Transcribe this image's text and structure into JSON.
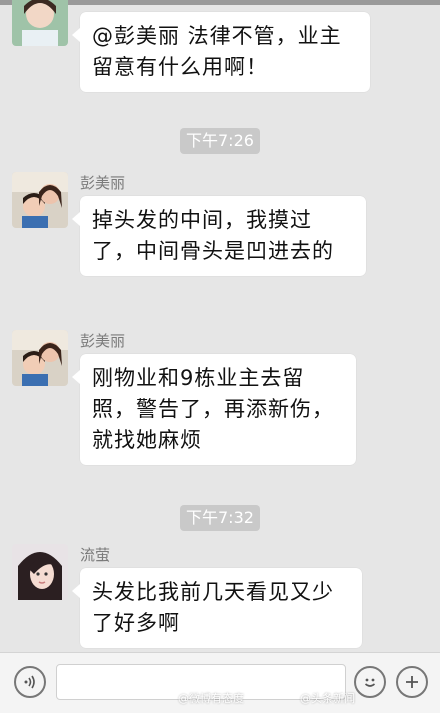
{
  "messages": [
    {
      "sender": "",
      "text": "@彭美丽 法律不管，业主留意有什么用啊！"
    },
    {
      "sender": "彭美丽",
      "text": "掉头发的中间，我摸过了，中间骨头是凹进去的"
    },
    {
      "sender": "彭美丽",
      "text": "刚物业和9栋业主去留照，警告了，再添新伤，就找她麻烦"
    },
    {
      "sender": "流萤",
      "text": "头发比我前几天看见又少了好多啊"
    }
  ],
  "timestamps": [
    "下午7:26",
    "下午7:32"
  ],
  "input_bar": {
    "text_value": "",
    "icons": [
      "voice-icon",
      "emoji-icon",
      "plus-icon"
    ]
  },
  "watermarks": [
    "@微博有态度",
    "@头条新闻"
  ],
  "colors": {
    "background": "#e6e6e6",
    "bubble": "#ffffff",
    "timestamp_bg": "#c9c9c9",
    "sender_name": "#7a7a7a"
  }
}
